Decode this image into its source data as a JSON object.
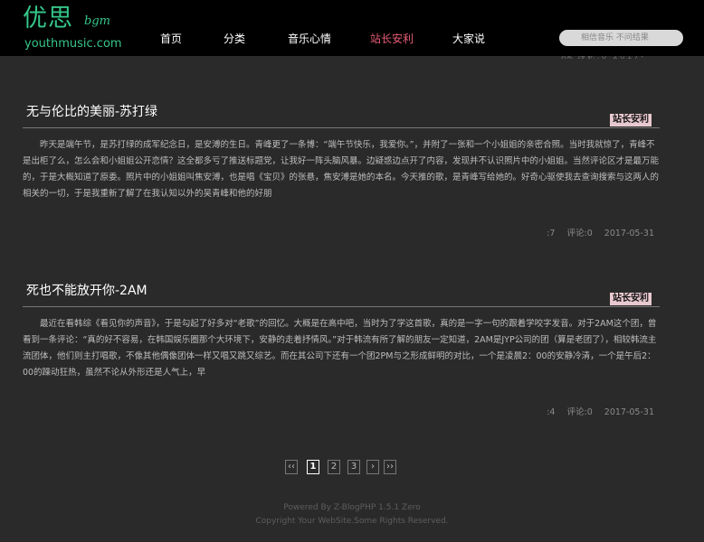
{
  "header": {
    "logo_cn": "优思",
    "logo_sub": "bgm",
    "logo_url": "youthmusic.com",
    "nav": [
      {
        "label": "首页"
      },
      {
        "label": "分类"
      },
      {
        "label": "音乐心情"
      },
      {
        "label": "站长安利"
      },
      {
        "label": "大家说"
      }
    ],
    "search_placeholder": "相信音乐 不问结果",
    "top_cut_text": ":7 评论:0 2017-05-31"
  },
  "articles": [
    {
      "title": "无与伦比的美丽-苏打绿",
      "tag": "站长安利",
      "body": "昨天是端午节，是苏打绿的成军纪念日，是安溥的生日。青峰更了一条博：“端午节快乐，我爱你。”，并附了一张和一个小姐姐的亲密合照。当时我就惊了，青峰不是出柜了么，怎么会和小姐姐公开恋情？这全都多亏了推送标题党，让我好一阵头脑风暴。边疑惑边点开了内容，发现并不认识照片中的小姐姐。当然评论区才是最万能的，于是大概知道了原委。照片中的小姐姐叫焦安溥，也是唱《宝贝》的张悬，焦安溥是她的本名。今天推的歌，是青峰写给她的。好奇心驱使我去查询搜索与这两人的相关的一切，于是我重新了解了在我认知以外的吴青峰和他的好朋",
      "views": ":7",
      "comments": "评论:0",
      "date": "2017-05-31"
    },
    {
      "title": "死也不能放开你-2AM",
      "tag": "站长安利",
      "body": "最近在看韩综《看见你的声音》，于是勾起了好多对“老歌”的回忆。大概是在高中吧，当时为了学这首歌，真的是一字一句的跟着学咬字发音。对于2AM这个团，曾看到一条评论：“真的好不容易，在韩国娱乐圈那个大环境下，安静的走着抒情风。”对于韩流有所了解的朋友一定知道，2AM是JYP公司的团（算是老团了），相较韩流主流团体，他们则主打唱歌，不像其他偶像团体一样又唱又跳又综艺。而在其公司下还有一个团2PM与之形成鲜明的对比，一个是凌晨2：00的安静冷清，一个是午后2：00的躁动狂热，虽然不论从外形还是人气上，早",
      "views": ":4",
      "comments": "评论:0",
      "date": "2017-05-31"
    }
  ],
  "pagination": {
    "first": "‹‹",
    "pages": [
      "1",
      "2",
      "3"
    ],
    "current": "1",
    "next": "›",
    "last": "››"
  },
  "footer": {
    "powered": "Powered By Z-BlogPHP 1.5.1 Zero",
    "copyright": "Copyright Your WebSite.Some Rights Reserved."
  },
  "colors": {
    "accent_green": "#35c68a",
    "nav_active": "#e65c74",
    "tag_bg": "#e8c9d0",
    "page_bg": "#2a2a2a",
    "header_bg": "#000000"
  }
}
